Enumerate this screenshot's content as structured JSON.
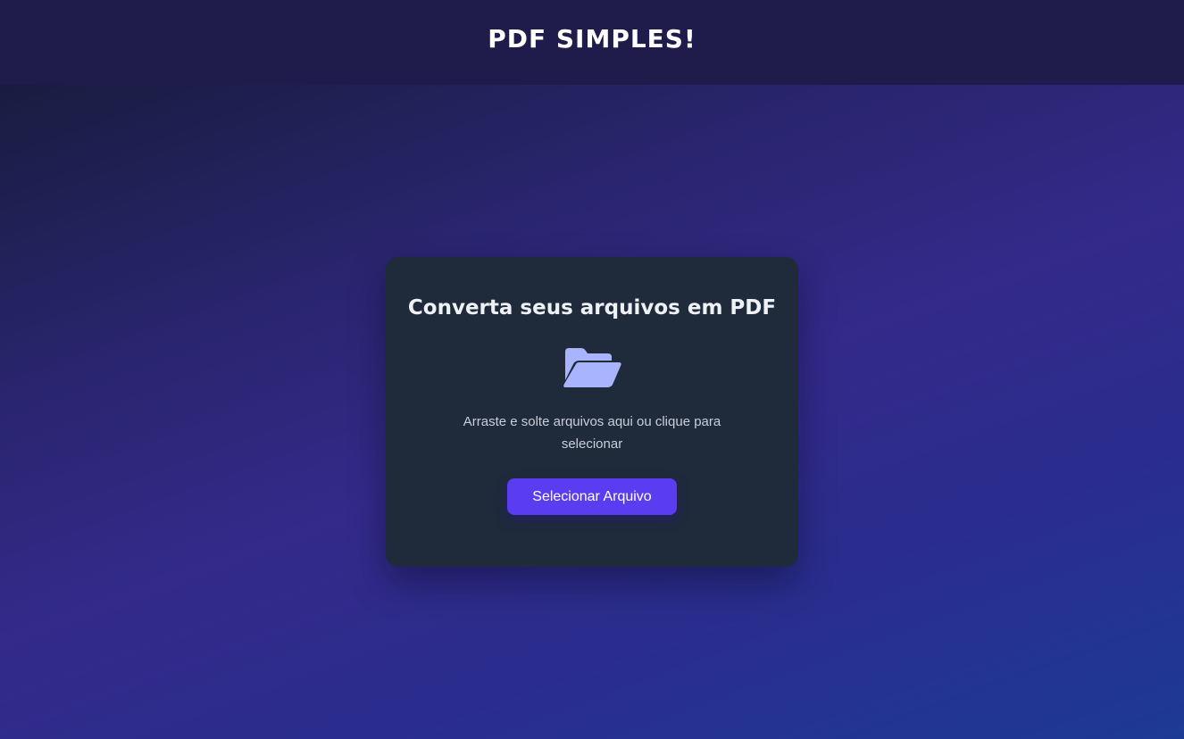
{
  "header": {
    "logo_text": "PDF SIMPLES!"
  },
  "card": {
    "title": "Converta seus arquivos em PDF",
    "icon": "folder-open-icon",
    "hint": "Arraste e solte arquivos aqui ou clique para selecionar",
    "button_label": "Selecionar Arquivo"
  },
  "colors": {
    "header_bg": "#1f1b4a",
    "card_bg": "#1f2a3a",
    "accent": "#5a3df0",
    "icon": "#a9b4ff"
  }
}
